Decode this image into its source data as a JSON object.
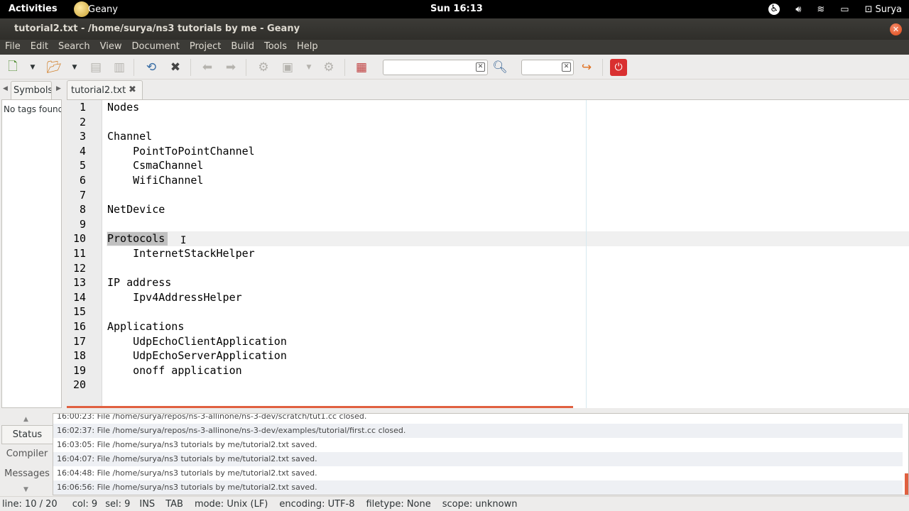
{
  "topbar": {
    "activities": "Activities",
    "app_name": "Geany",
    "clock": "Sun 16:13",
    "user": "Surya",
    "tray_icons": [
      "accessibility-icon",
      "volume-icon",
      "wifi-icon",
      "battery-icon",
      "user-icon"
    ]
  },
  "window": {
    "title": "tutorial2.txt - /home/surya/ns3 tutorials by me - Geany",
    "close_glyph": "✕"
  },
  "menu": [
    "File",
    "Edit",
    "Search",
    "View",
    "Document",
    "Project",
    "Build",
    "Tools",
    "Help"
  ],
  "sidebar": {
    "tab_label": "Symbols",
    "no_tags": "No tags found"
  },
  "doc_tab": {
    "label": "tutorial2.txt",
    "close_glyph": "✖"
  },
  "editor": {
    "lines": [
      "Nodes",
      "",
      "Channel",
      "    PointToPointChannel",
      "    CsmaChannel",
      "    WifiChannel",
      "",
      "NetDevice",
      "",
      "Protocols",
      "    InternetStackHelper",
      "",
      "IP address",
      "    Ipv4AddressHelper",
      "",
      "Applications",
      "    UdpEchoClientApplication",
      "    UdpEchoServerApplication",
      "    onoff application",
      ""
    ],
    "current_line": 10,
    "selected_text": "Protocols"
  },
  "messages": {
    "tabs": [
      "Status",
      "Compiler",
      "Messages"
    ],
    "active_tab": "Status",
    "rows": [
      "16:00:23: File /home/surya/repos/ns-3-allinone/ns-3-dev/scratch/tut1.cc closed.",
      "16:02:37: File /home/surya/repos/ns-3-allinone/ns-3-dev/examples/tutorial/first.cc closed.",
      "16:03:05: File /home/surya/ns3 tutorials by me/tutorial2.txt saved.",
      "16:04:07: File /home/surya/ns3 tutorials by me/tutorial2.txt saved.",
      "16:04:48: File /home/surya/ns3 tutorials by me/tutorial2.txt saved.",
      "16:06:56: File /home/surya/ns3 tutorials by me/tutorial2.txt saved."
    ]
  },
  "status": {
    "line": "line: 10 / 20",
    "col": "col: 9",
    "sel": "sel: 9",
    "ins": "INS",
    "tab": "TAB",
    "mode": "mode: Unix (LF)",
    "encoding": "encoding: UTF-8",
    "filetype": "filetype: None",
    "scope": "scope: unknown"
  },
  "colors": {
    "accent": "#dd4814",
    "panel": "#000000",
    "titlebar": "#3c3b37"
  }
}
